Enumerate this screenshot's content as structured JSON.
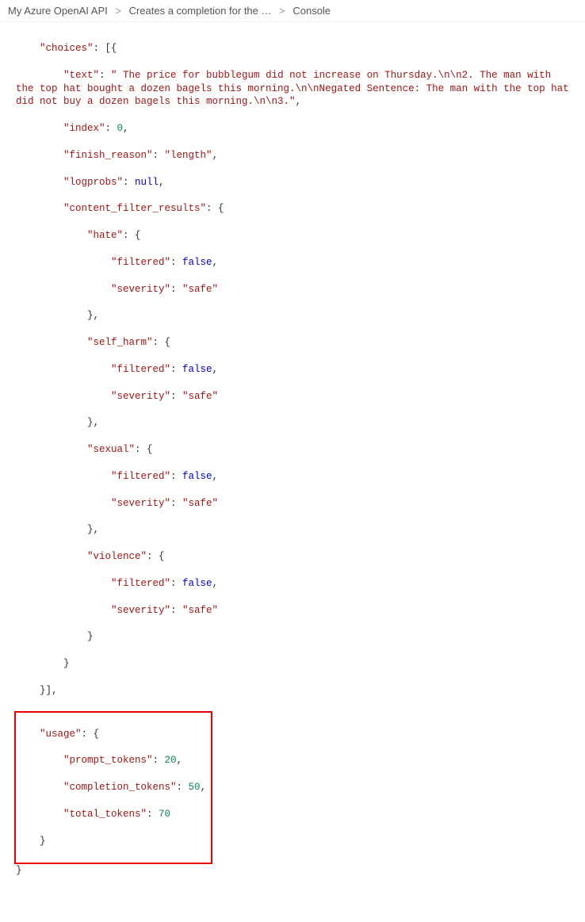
{
  "breadcrumb": {
    "item1": "My Azure OpenAI API",
    "item2": "Creates a completion for the …",
    "item3": "Console",
    "sep": ">"
  },
  "json": {
    "choices_key": "\"choices\"",
    "choices_open": ": [{",
    "text_key": "\"text\"",
    "text_val": "\" The price for bubblegum did not increase on Thursday.\\n\\n2. The man with the top hat bought a dozen bagels this morning.\\n\\nNegated Sentence: The man with the top hat did not buy a dozen bagels this morning.\\n\\n3.\"",
    "index_key": "\"index\"",
    "index_val": "0",
    "finish_key": "\"finish_reason\"",
    "finish_val": "\"length\"",
    "logprobs_key": "\"logprobs\"",
    "logprobs_val": "null",
    "cfr_key": "\"content_filter_results\"",
    "hate_key": "\"hate\"",
    "selfharm_key": "\"self_harm\"",
    "sexual_key": "\"sexual\"",
    "violence_key": "\"violence\"",
    "filtered_key": "\"filtered\"",
    "filtered_val": "false",
    "severity_key": "\"severity\"",
    "severity_val": "\"safe\"",
    "usage_key": "\"usage\"",
    "prompt_key": "\"prompt_tokens\"",
    "prompt_val": "20",
    "completion_key": "\"completion_tokens\"",
    "completion_val": "50",
    "total_key": "\"total_tokens\"",
    "total_val": "70",
    "close_arr": "}],",
    "open_brace": ": {",
    "close_brace": "}",
    "close_brace_comma": "},",
    "colon_space": ": ",
    "comma": ","
  }
}
